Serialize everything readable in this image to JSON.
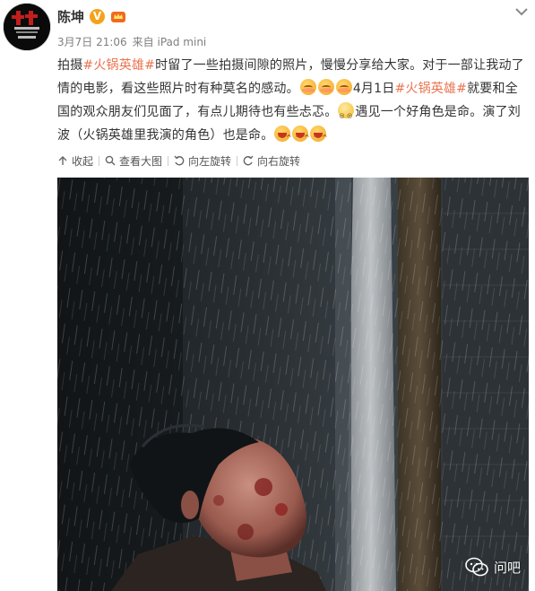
{
  "post": {
    "author": "陈坤",
    "verified_badge": "V",
    "timestamp": "3月7日 21:06",
    "source": "来自 iPad mini",
    "text_segments": [
      {
        "type": "text",
        "value": "拍摄"
      },
      {
        "type": "topic",
        "value": "#火锅英雄#"
      },
      {
        "type": "text",
        "value": "时留了一些拍摄间隙的照片，慢慢分享给大家。对于一部让我动了情的电影，看这些照片时有种莫名的感动。"
      },
      {
        "type": "emoji",
        "value": "blush"
      },
      {
        "type": "emoji",
        "value": "blush"
      },
      {
        "type": "emoji",
        "value": "blush"
      },
      {
        "type": "text",
        "value": "4月1日"
      },
      {
        "type": "topic",
        "value": "#火锅英雄#"
      },
      {
        "type": "text",
        "value": "就要和全国的观众朋友们见面了，有点儿期待也有些忐忑。"
      },
      {
        "type": "emoji",
        "value": "dizzy"
      },
      {
        "type": "text",
        "value": "遇见一个好角色是命。演了刘波（火锅英雄里我演的角色）也是命。"
      },
      {
        "type": "emoji",
        "value": "laugh"
      },
      {
        "type": "emoji",
        "value": "laugh"
      },
      {
        "type": "emoji",
        "value": "laugh"
      }
    ]
  },
  "toolbar": {
    "collapse_label": "收起",
    "view_large_label": "查看大图",
    "rotate_left_label": "向左旋转",
    "rotate_right_label": "向右旋转"
  },
  "watermark": {
    "label": "问吧"
  },
  "colors": {
    "topic": "#eb7350",
    "meta": "#808080",
    "badge": "#f5a21b"
  }
}
